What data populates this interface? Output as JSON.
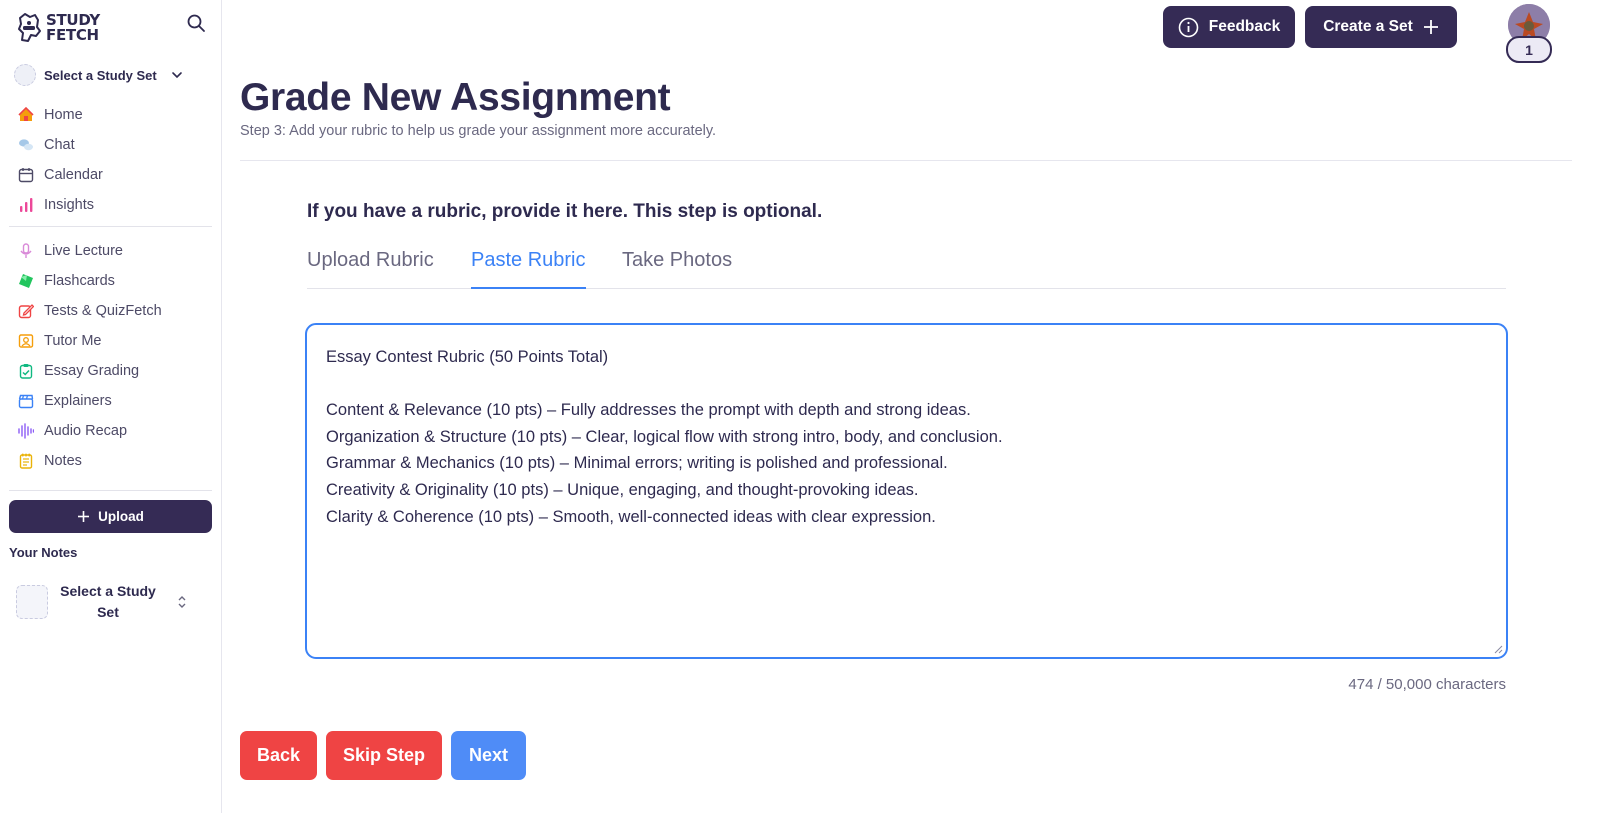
{
  "brand": {
    "logo_line1": "STUDY",
    "logo_line2": "FETCH"
  },
  "sidebar": {
    "study_set_select": "Select a Study Set",
    "nav_primary": [
      {
        "label": "Home",
        "icon": "home-icon"
      },
      {
        "label": "Chat",
        "icon": "chat-icon"
      },
      {
        "label": "Calendar",
        "icon": "calendar-icon"
      },
      {
        "label": "Insights",
        "icon": "bar-chart-icon"
      }
    ],
    "nav_tools": [
      {
        "label": "Live Lecture",
        "icon": "microphone-icon"
      },
      {
        "label": "Flashcards",
        "icon": "flashcards-icon"
      },
      {
        "label": "Tests & QuizFetch",
        "icon": "pencil-edit-icon"
      },
      {
        "label": "Tutor Me",
        "icon": "tutor-icon"
      },
      {
        "label": "Essay Grading",
        "icon": "clipboard-check-icon"
      },
      {
        "label": "Explainers",
        "icon": "clapperboard-icon"
      },
      {
        "label": "Audio Recap",
        "icon": "audio-wave-icon"
      },
      {
        "label": "Notes",
        "icon": "notepad-icon"
      }
    ],
    "upload_label": "Upload",
    "your_notes_label": "Your Notes",
    "notes_select_label": "Select a Study Set"
  },
  "header": {
    "feedback_label": "Feedback",
    "create_set_label": "Create a Set",
    "avatar_badge": "1"
  },
  "main": {
    "title": "Grade New Assignment",
    "subtitle": "Step 3: Add your rubric to help us grade your assignment more accurately.",
    "prompt": "If you have a rubric, provide it here. This step is optional.",
    "tabs": [
      {
        "label": "Upload Rubric",
        "active": false
      },
      {
        "label": "Paste Rubric",
        "active": true
      },
      {
        "label": "Take Photos",
        "active": false
      }
    ],
    "rubric_lines": [
      "Essay Contest Rubric (50 Points Total)",
      "",
      "Content & Relevance (10 pts) – Fully addresses the prompt with depth and strong ideas.",
      "Organization & Structure (10 pts) – Clear, logical flow with strong intro, body, and conclusion.",
      "Grammar & Mechanics (10 pts) – Minimal errors; writing is polished and professional.",
      "Creativity & Originality (10 pts) – Unique, engaging, and thought-provoking ideas.",
      "Clarity & Coherence (10 pts) – Smooth, well-connected ideas with clear expression."
    ],
    "char_count": "474 / 50,000 characters",
    "buttons": {
      "back": "Back",
      "skip": "Skip Step",
      "next": "Next"
    }
  },
  "colors": {
    "brand_dark": "#352b55",
    "accent_blue": "#3b82f6",
    "danger_red": "#ef4444",
    "next_blue": "#4f8cf7"
  }
}
